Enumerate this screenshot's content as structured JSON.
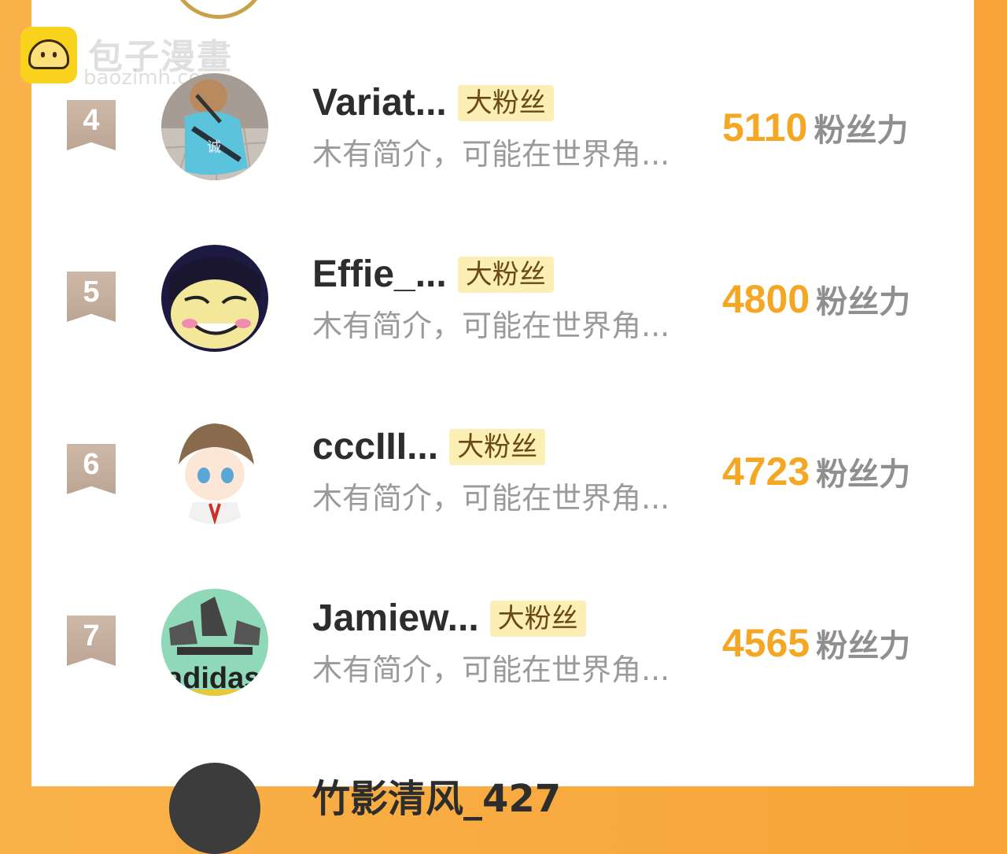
{
  "watermark": {
    "title": "包子漫畫",
    "url": "baozimh.com"
  },
  "rows": [
    {
      "rank": "4",
      "name": "Variat...",
      "badge": "大粉丝",
      "desc": "木有简介，可能在世界角...",
      "power": "5110",
      "unit": "粉丝力",
      "avatar": "dog-photo"
    },
    {
      "rank": "5",
      "name": "Effie_...",
      "badge": "大粉丝",
      "desc": "木有简介，可能在世界角...",
      "power": "4800",
      "unit": "粉丝力",
      "avatar": "anime-smiling-face"
    },
    {
      "rank": "6",
      "name": "cccIII...",
      "badge": "大粉丝",
      "desc": "木有简介，可能在世界角...",
      "power": "4723",
      "unit": "粉丝力",
      "avatar": "chibi-boy"
    },
    {
      "rank": "7",
      "name": "Jamiew...",
      "badge": "大粉丝",
      "desc": "木有简介，可能在世界角...",
      "power": "4565",
      "unit": "粉丝力",
      "avatar": "adidas-sneakers"
    }
  ],
  "partial_row": {
    "name": "竹影清风_427"
  },
  "colors": {
    "accent": "#f5a623",
    "badge_bg": "#fcefb5",
    "rank_ribbon": "#c7b19f",
    "frame": "#f9b24a"
  }
}
